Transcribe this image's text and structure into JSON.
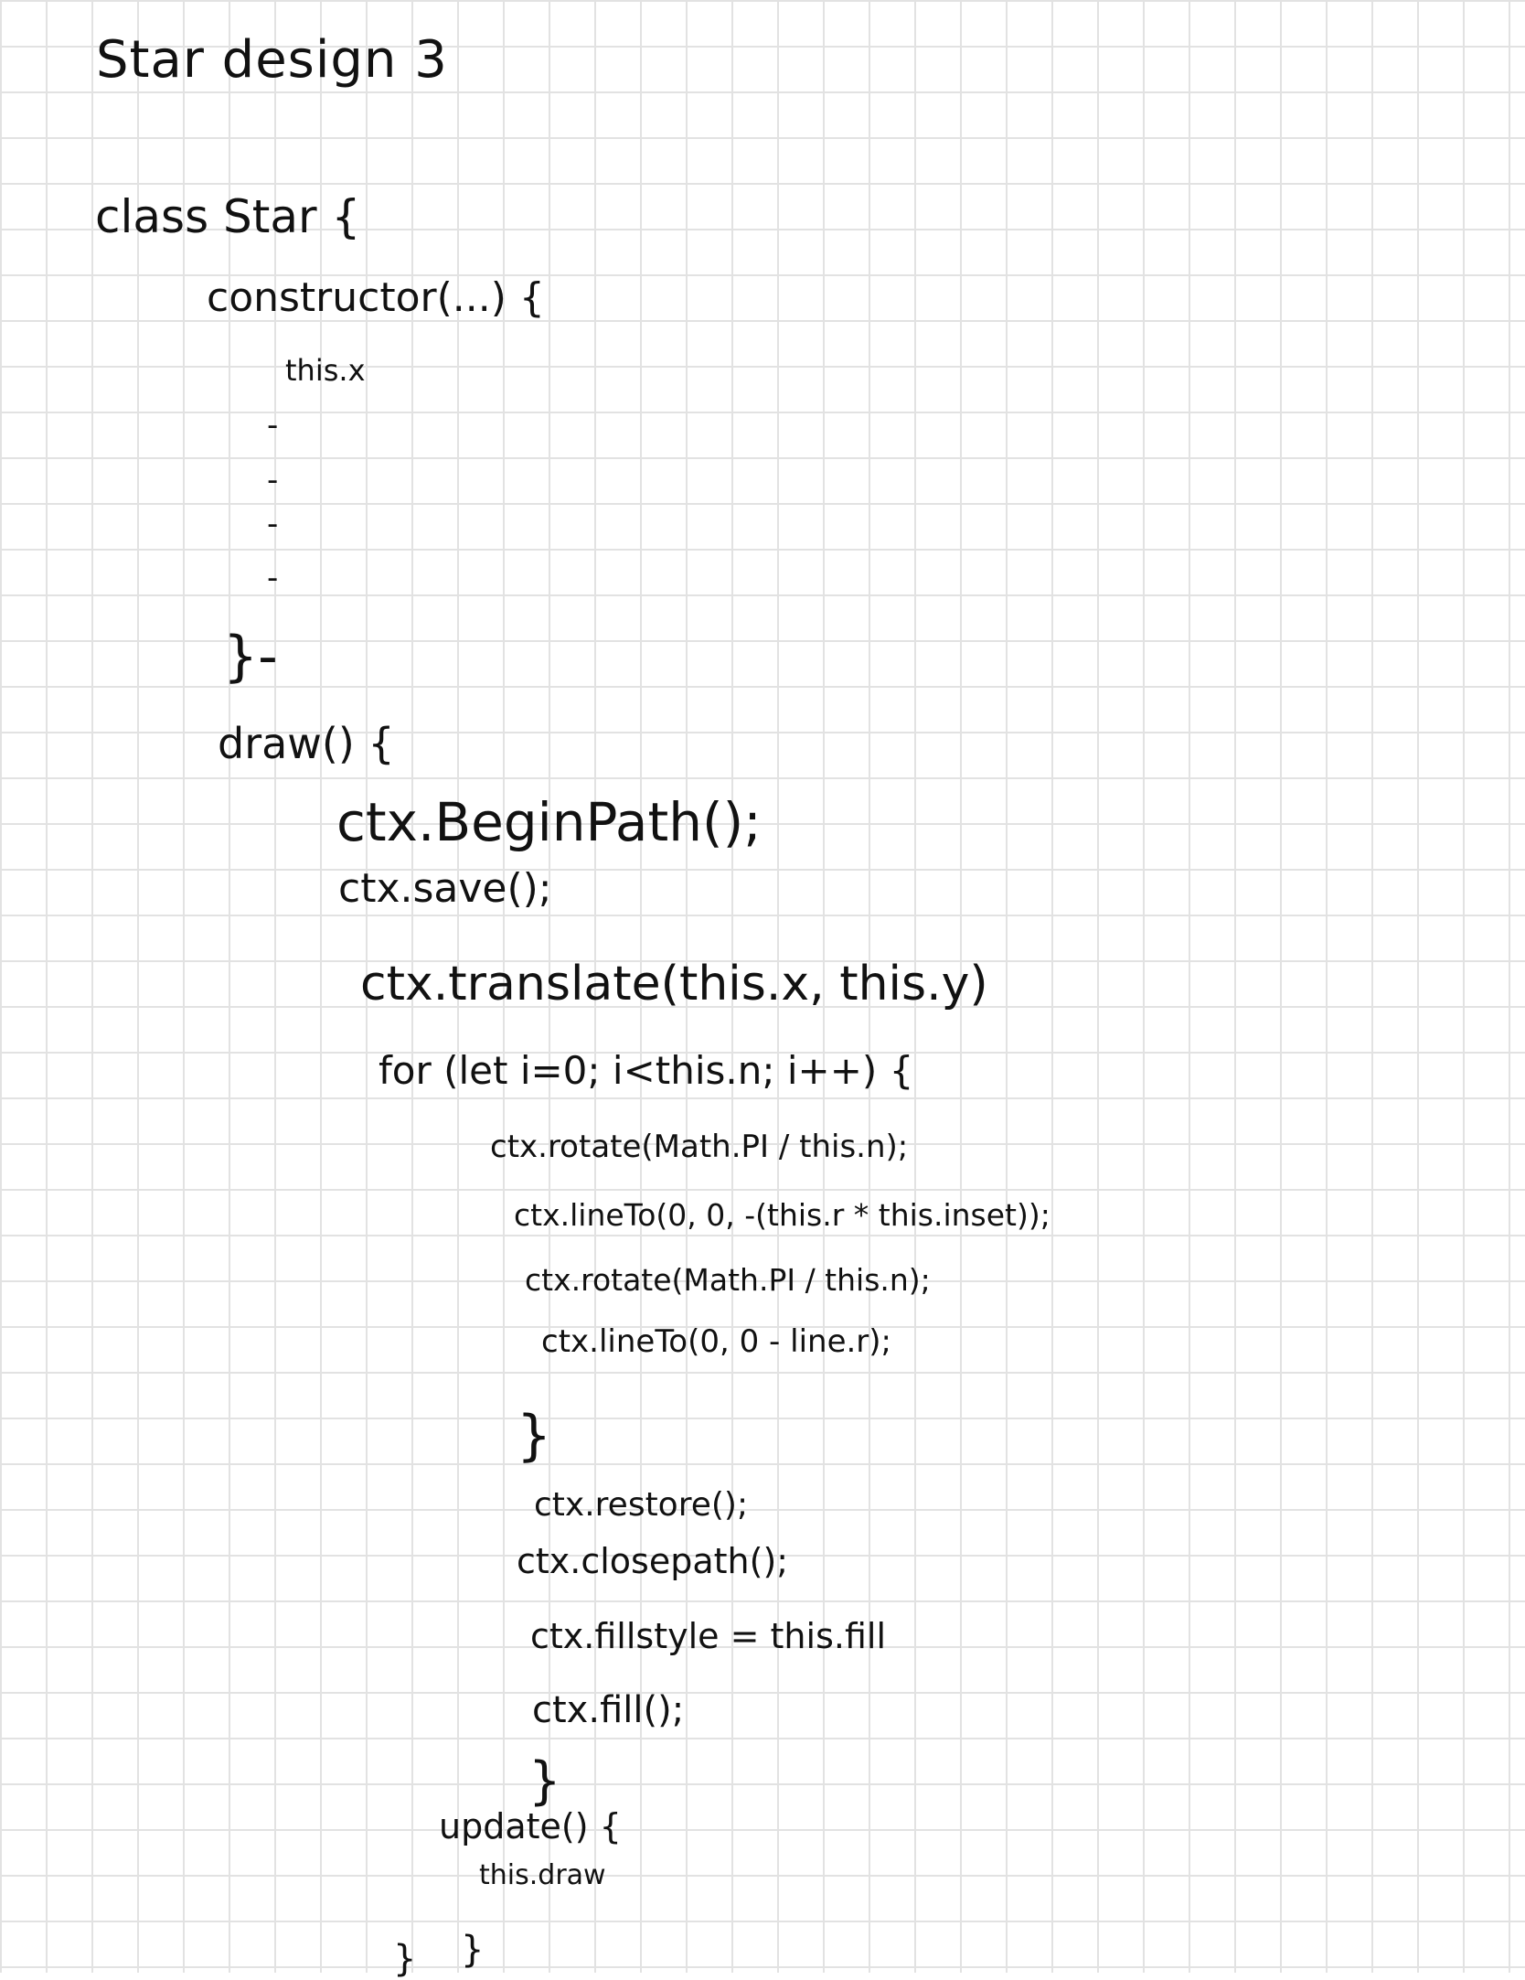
{
  "title": "Star design 3",
  "code": {
    "class_line": "class Star {",
    "constructor_line": "constructor(...) {",
    "this_x": "this.x",
    "dash_1": "-",
    "dash_2": "-",
    "dash_3": "-",
    "dash_4": "-",
    "constructor_end": "}-",
    "draw_line": "draw() {",
    "begin_path": "ctx.BeginPath();",
    "save": "ctx.save();",
    "translate": "ctx.translate(this.x, this.y)",
    "for_loop": "for (let i=0; i<this.n; i++) {",
    "rotate_1": "ctx.rotate(Math.PI / this.n);",
    "line_to_1": "ctx.lineTo(0, 0, -(this.r * this.inset));",
    "rotate_2": "ctx.rotate(Math.PI / this.n);",
    "line_to_2": "ctx.lineTo(0, 0 - line.r);",
    "for_end": "}",
    "restore": "ctx.restore();",
    "close_path": "ctx.closepath();",
    "fill_style": "ctx.fillstyle = this.fill",
    "fill": "ctx.fill();",
    "draw_end": "}",
    "update_line": "update() {",
    "this_draw": "this.draw",
    "update_end": "}",
    "class_end": "}"
  }
}
